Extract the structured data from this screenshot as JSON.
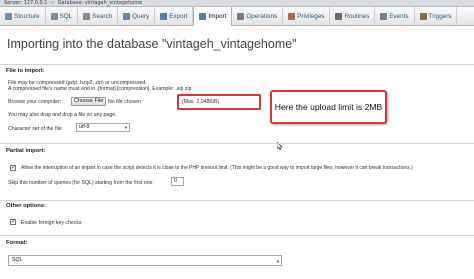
{
  "breadcrumb": {
    "server": "Server: 127.0.0.1",
    "database": "Database: vintageh_vintagehome"
  },
  "tabs": [
    {
      "label": "Structure",
      "icon": "structure-icon",
      "color": "#6a8fb0"
    },
    {
      "label": "SQL",
      "icon": "sql-icon",
      "color": "#7a8aa0"
    },
    {
      "label": "Search",
      "icon": "search-icon",
      "color": "#888888"
    },
    {
      "label": "Query",
      "icon": "query-icon",
      "color": "#5d86b5"
    },
    {
      "label": "Export",
      "icon": "export-icon",
      "color": "#4f7fb0"
    },
    {
      "label": "Import",
      "icon": "import-icon",
      "color": "#4f7fb0"
    },
    {
      "label": "Operations",
      "icon": "operations-icon",
      "color": "#7a7a7a"
    },
    {
      "label": "Privileges",
      "icon": "privileges-icon",
      "color": "#b06a4a"
    },
    {
      "label": "Routines",
      "icon": "routines-icon",
      "color": "#6a6a6a"
    },
    {
      "label": "Events",
      "icon": "events-icon",
      "color": "#7d7d9a"
    },
    {
      "label": "Triggers",
      "icon": "triggers-icon",
      "color": "#8a6a4a"
    }
  ],
  "page": {
    "title": "Importing into the database \"vintageh_vintagehome\""
  },
  "file_to_import": {
    "heading": "File to import:",
    "compress_note": "File may be compressed (gzip, bzip2, zip) or uncompressed.",
    "name_note": "A compressed file's name must end in .[format].[compression]. Example: .sql.zip",
    "browse_label": "Browse your computer:",
    "choose_file": "Choose File",
    "no_file": "No file chosen",
    "max_size": "(Max: 2,048KiB)",
    "drag_note": "You may also drag and drop a file on any page.",
    "charset_label": "Character set of the file:",
    "charset_value": "utf-8"
  },
  "callout": {
    "text": "Here the upload limit is 2MB"
  },
  "partial_import": {
    "heading": "Partial import:",
    "allow_interrupt": "Allow the interruption of an import in case the script detects it is close to the PHP timeout limit. (This might be a good way to import large files, however it can break transactions.)",
    "allow_checked": true,
    "skip_label": "Skip this number of queries (for SQL) starting from the first one:",
    "skip_value": "0"
  },
  "other_options": {
    "heading": "Other options:",
    "foreign_keys": "Enable foreign key checks",
    "foreign_checked": true
  },
  "format": {
    "heading": "Format:",
    "value": "SQL"
  },
  "colors": {
    "accent": "#d23b3b",
    "tab_text": "#235a81"
  }
}
